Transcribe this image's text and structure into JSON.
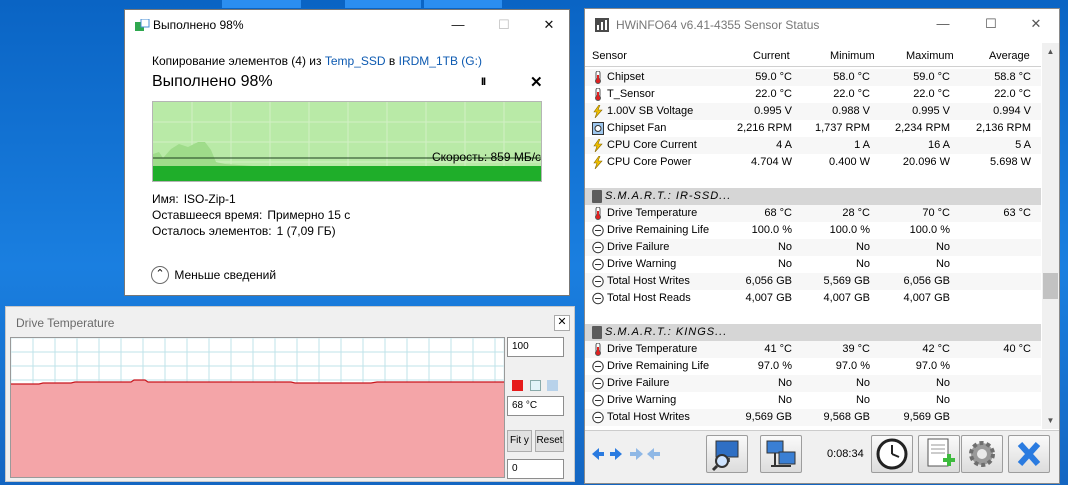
{
  "copy_dialog": {
    "title": "Выполнено 98%",
    "line_prefix": "Копирование элементов (4) из",
    "source": "Temp_SSD",
    "line_mid": "в",
    "dest": "IRDM_1TB (G:)",
    "heading": "Выполнено 98%",
    "pause": "II",
    "cancel": "✕",
    "speed": "Скорость: 859 МБ/с",
    "name_label": "Имя:",
    "name_value": "ISO-Zip-1",
    "time_label": "Оставшееся время:",
    "time_value": "Примерно 15 с",
    "items_label": "Осталось элементов:",
    "items_value": "1 (7,09 ГБ)",
    "less_details": "Меньше сведений",
    "less_icon": "⌃",
    "win_min": "—",
    "win_max": "☐",
    "win_close": "✕",
    "accent_color": "#2fb52f",
    "fill_color": "#b9eaa7",
    "progress_percent": 98
  },
  "temp_graph": {
    "title": "Drive Temperature",
    "close": "✕",
    "max_value": "100",
    "current_value": "68 °C",
    "min_value": "0",
    "fit_button": "Fit y",
    "reset_button": "Reset",
    "fill_color": "#f4a5a8",
    "line_color": "#c8161d",
    "grid_color": "#bfe3ea",
    "legend_colors": [
      "#e61b1b",
      "#e2f3f8",
      "#b8d2ea"
    ]
  },
  "hwinfo": {
    "title": "HWiNFO64 v6.41-4355 Sensor Status",
    "win_min": "—",
    "win_max": "☐",
    "win_close": "✕",
    "columns": [
      "Sensor",
      "Current",
      "Minimum",
      "Maximum",
      "Average"
    ],
    "rows": [
      {
        "kind": "sensor",
        "icon": "thermometer-icon",
        "name": "Chipset",
        "current": "59.0 °C",
        "min": "58.0 °C",
        "max": "59.0 °C",
        "avg": "58.8 °C"
      },
      {
        "kind": "sensor",
        "icon": "thermometer-icon",
        "name": "T_Sensor",
        "current": "22.0 °C",
        "min": "22.0 °C",
        "max": "22.0 °C",
        "avg": "22.0 °C"
      },
      {
        "kind": "sensor",
        "icon": "lightning-icon",
        "name": "1.00V SB Voltage",
        "current": "0.995 V",
        "min": "0.988 V",
        "max": "0.995 V",
        "avg": "0.994 V"
      },
      {
        "kind": "sensor",
        "icon": "fan-icon",
        "name": "Chipset Fan",
        "current": "2,216 RPM",
        "min": "1,737 RPM",
        "max": "2,234 RPM",
        "avg": "2,136 RPM"
      },
      {
        "kind": "sensor",
        "icon": "lightning-icon",
        "name": "CPU Core Current",
        "current": "4 A",
        "min": "1 A",
        "max": "16 A",
        "avg": "5 A"
      },
      {
        "kind": "sensor",
        "icon": "lightning-icon",
        "name": "CPU Core Power",
        "current": "4.704 W",
        "min": "0.400 W",
        "max": "20.096 W",
        "avg": "5.698 W"
      },
      {
        "kind": "blank"
      },
      {
        "kind": "group",
        "name": "S.M.A.R.T.: IR-SSD..."
      },
      {
        "kind": "sensor",
        "icon": "thermometer-icon",
        "name": "Drive Temperature",
        "current": "68 °C",
        "min": "28 °C",
        "max": "70 °C",
        "avg": "63 °C"
      },
      {
        "kind": "sensor",
        "icon": "gauge-icon",
        "name": "Drive Remaining Life",
        "current": "100.0 %",
        "min": "100.0 %",
        "max": "100.0 %",
        "avg": ""
      },
      {
        "kind": "sensor",
        "icon": "gauge-icon",
        "name": "Drive Failure",
        "current": "No",
        "min": "No",
        "max": "No",
        "avg": ""
      },
      {
        "kind": "sensor",
        "icon": "gauge-icon",
        "name": "Drive Warning",
        "current": "No",
        "min": "No",
        "max": "No",
        "avg": ""
      },
      {
        "kind": "sensor",
        "icon": "gauge-icon",
        "name": "Total Host Writes",
        "current": "6,056 GB",
        "min": "5,569 GB",
        "max": "6,056 GB",
        "avg": ""
      },
      {
        "kind": "sensor",
        "icon": "gauge-icon",
        "name": "Total Host Reads",
        "current": "4,007 GB",
        "min": "4,007 GB",
        "max": "4,007 GB",
        "avg": ""
      },
      {
        "kind": "blank"
      },
      {
        "kind": "group",
        "name": "S.M.A.R.T.: KINGS..."
      },
      {
        "kind": "sensor",
        "icon": "thermometer-icon",
        "name": "Drive Temperature",
        "current": "41 °C",
        "min": "39 °C",
        "max": "42 °C",
        "avg": "40 °C"
      },
      {
        "kind": "sensor",
        "icon": "gauge-icon",
        "name": "Drive Remaining Life",
        "current": "97.0 %",
        "min": "97.0 %",
        "max": "97.0 %",
        "avg": ""
      },
      {
        "kind": "sensor",
        "icon": "gauge-icon",
        "name": "Drive Failure",
        "current": "No",
        "min": "No",
        "max": "No",
        "avg": ""
      },
      {
        "kind": "sensor",
        "icon": "gauge-icon",
        "name": "Drive Warning",
        "current": "No",
        "min": "No",
        "max": "No",
        "avg": ""
      },
      {
        "kind": "sensor",
        "icon": "gauge-icon",
        "name": "Total Host Writes",
        "current": "9,569 GB",
        "min": "9,568 GB",
        "max": "9,569 GB",
        "avg": ""
      }
    ],
    "scroll_up": "▲",
    "scroll_down": "▼",
    "elapsed": "0:08:34",
    "toolbar": [
      "arrows-expand-icon",
      "arrows-collapse-icon",
      "monitor-search-icon",
      "network-icon",
      "clock-icon",
      "report-add-icon",
      "settings-gear-icon",
      "close-x-icon"
    ]
  }
}
